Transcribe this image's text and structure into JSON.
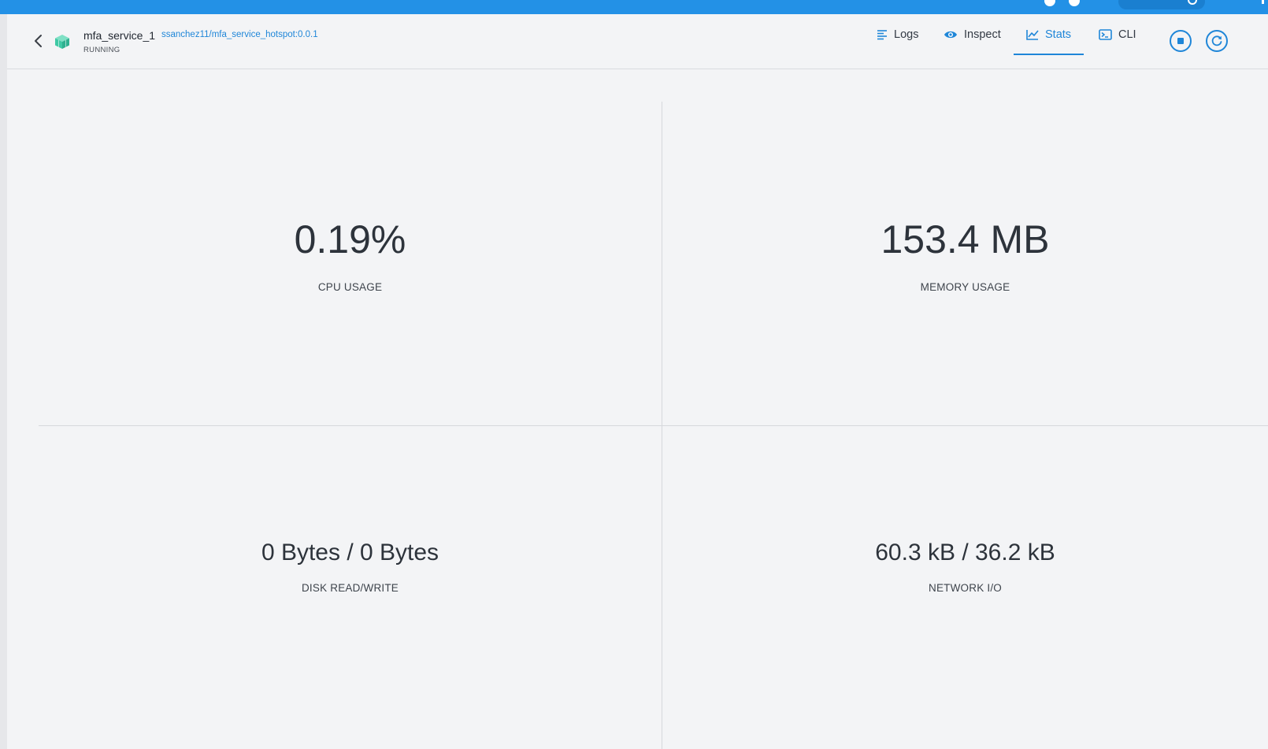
{
  "container": {
    "name": "mfa_service_1",
    "image": "ssanchez11/mfa_service_hotspot:0.0.1",
    "status": "RUNNING"
  },
  "tabs": [
    {
      "label": "Logs",
      "icon": "logs-icon",
      "active": false
    },
    {
      "label": "Inspect",
      "icon": "eye-icon",
      "active": false
    },
    {
      "label": "Stats",
      "icon": "chart-icon",
      "active": true
    },
    {
      "label": "CLI",
      "icon": "terminal-icon",
      "active": false
    }
  ],
  "actions": {
    "stop": "stop-icon",
    "restart": "restart-icon"
  },
  "stats": {
    "cpu": {
      "value": "0.19%",
      "label": "CPU USAGE"
    },
    "memory": {
      "value": "153.4 MB",
      "label": "MEMORY USAGE"
    },
    "disk": {
      "value": "0 Bytes / 0 Bytes",
      "label": "DISK READ/WRITE"
    },
    "network": {
      "value": "60.3 kB / 36.2 kB",
      "label": "NETWORK I/O"
    }
  },
  "colors": {
    "accent": "#1f86d8",
    "topbar": "#2391e6",
    "container_icon": "#3fc9a5"
  }
}
